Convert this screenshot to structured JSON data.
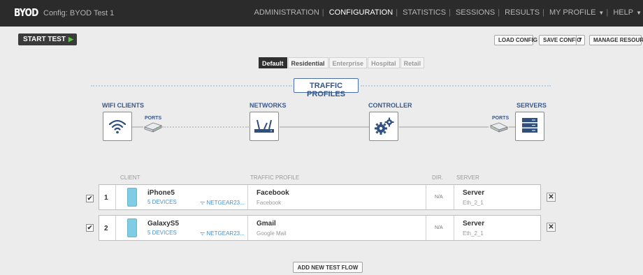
{
  "header": {
    "brand": "BYOD",
    "config_label": "Config: BYOD Test 1",
    "nav": [
      {
        "label": "ADMINISTRATION",
        "active": false
      },
      {
        "label": "CONFIGURATION",
        "active": true
      },
      {
        "label": "STATISTICS",
        "active": false
      },
      {
        "label": "SESSIONS",
        "active": false
      },
      {
        "label": "RESULTS",
        "active": false
      },
      {
        "label": "MY PROFILE",
        "active": false
      },
      {
        "label": "HELP",
        "active": false
      }
    ]
  },
  "toolbar": {
    "start_test": "START TEST",
    "load_config": "LOAD CONFIG",
    "save_config": "SAVE CONFIG",
    "manage_resources": "MANAGE RESOURCES"
  },
  "tabs": [
    "Default",
    "Residential",
    "Enterprise",
    "Hospital",
    "Retail"
  ],
  "diagram": {
    "banner": "TRAFFIC PROFILES",
    "wifi_clients": "WIFI CLIENTS",
    "networks": "NETWORKS",
    "controller": "CONTROLLER",
    "servers": "SERVERS",
    "ports_left": "PORTS",
    "ports_right": "PORTS"
  },
  "table": {
    "headers": {
      "client": "CLIENT",
      "traffic_profile": "TRAFFIC PROFILE",
      "dir": "DIR.",
      "server": "SERVER"
    },
    "rows": [
      {
        "checked": "✔",
        "num": "1",
        "device": "iPhone5",
        "devices": "5 DEVICES",
        "network": "NETGEAR23...",
        "profile": "Facebook",
        "profile_sub": "Facebook",
        "dir": "N/A",
        "server": "Server",
        "server_sub": "Eth_2_1"
      },
      {
        "checked": "✔",
        "num": "2",
        "device": "GalaxyS5",
        "devices": "5 DEVICES",
        "network": "NETGEAR23...",
        "profile": "Gmail",
        "profile_sub": "Google Mail",
        "dir": "N/A",
        "server": "Server",
        "server_sub": "Eth_2_1"
      }
    ],
    "delete_glyph": "✕"
  },
  "add_flow": "ADD NEW TEST FLOW",
  "colors": {
    "topbar": "#2b2b2b",
    "accent": "#3c5789",
    "link": "#4a90c8",
    "play": "#5fc04c"
  }
}
